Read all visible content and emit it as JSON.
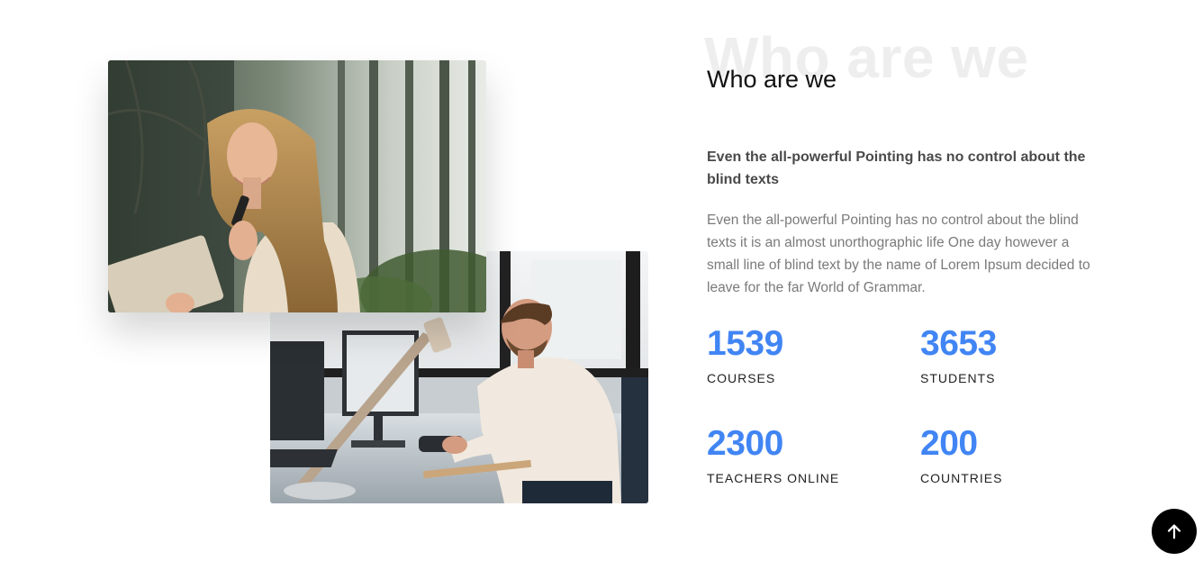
{
  "about": {
    "bg_title": "Who are we",
    "title": "Who are we",
    "lead": "Even the all-powerful Pointing has no control about the blind texts",
    "body": "Even the all-powerful Pointing has no control about the blind texts it is an almost unorthographic life One day however a small line of blind text by the name of Lorem Ipsum decided to leave for the far World of Grammar."
  },
  "stats": [
    {
      "number": "1539",
      "label": "COURSES"
    },
    {
      "number": "3653",
      "label": "STUDENTS"
    },
    {
      "number": "2300",
      "label": "TEACHERS ONLINE"
    },
    {
      "number": "200",
      "label": "COUNTRIES"
    }
  ],
  "colors": {
    "accent": "#4185f4",
    "heading": "#111111",
    "lead_text": "#4a4a4a",
    "body_text": "#7a7a7a",
    "watermark": "#eeeeee",
    "back_to_top_bg": "#000000"
  },
  "icons": {
    "back_to_top": "arrow-up-icon"
  }
}
